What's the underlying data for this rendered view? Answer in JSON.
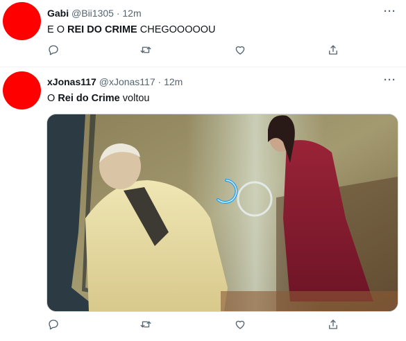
{
  "tweets": [
    {
      "display_name": "Gabi",
      "handle": "@Bii1305",
      "sep": "·",
      "time": "12m",
      "text_parts": [
        "E O ",
        "REI DO CRIME",
        " CHEGOOOOOU"
      ],
      "avatar_color": "#ff0000"
    },
    {
      "display_name": "xJonas117",
      "handle": "@xJonas117",
      "sep": "·",
      "time": "12m",
      "text_parts": [
        "O ",
        "Rei do Crime",
        " voltou"
      ],
      "avatar_color": "#ff0000"
    }
  ],
  "icons": {
    "more": "more-horizontal-icon",
    "reply": "reply-icon",
    "retweet": "retweet-icon",
    "like": "like-icon",
    "share": "share-icon"
  },
  "colors": {
    "muted": "#536471",
    "text": "#0f1419",
    "divider": "#eff3f4",
    "loader": "#1d9bf0"
  }
}
